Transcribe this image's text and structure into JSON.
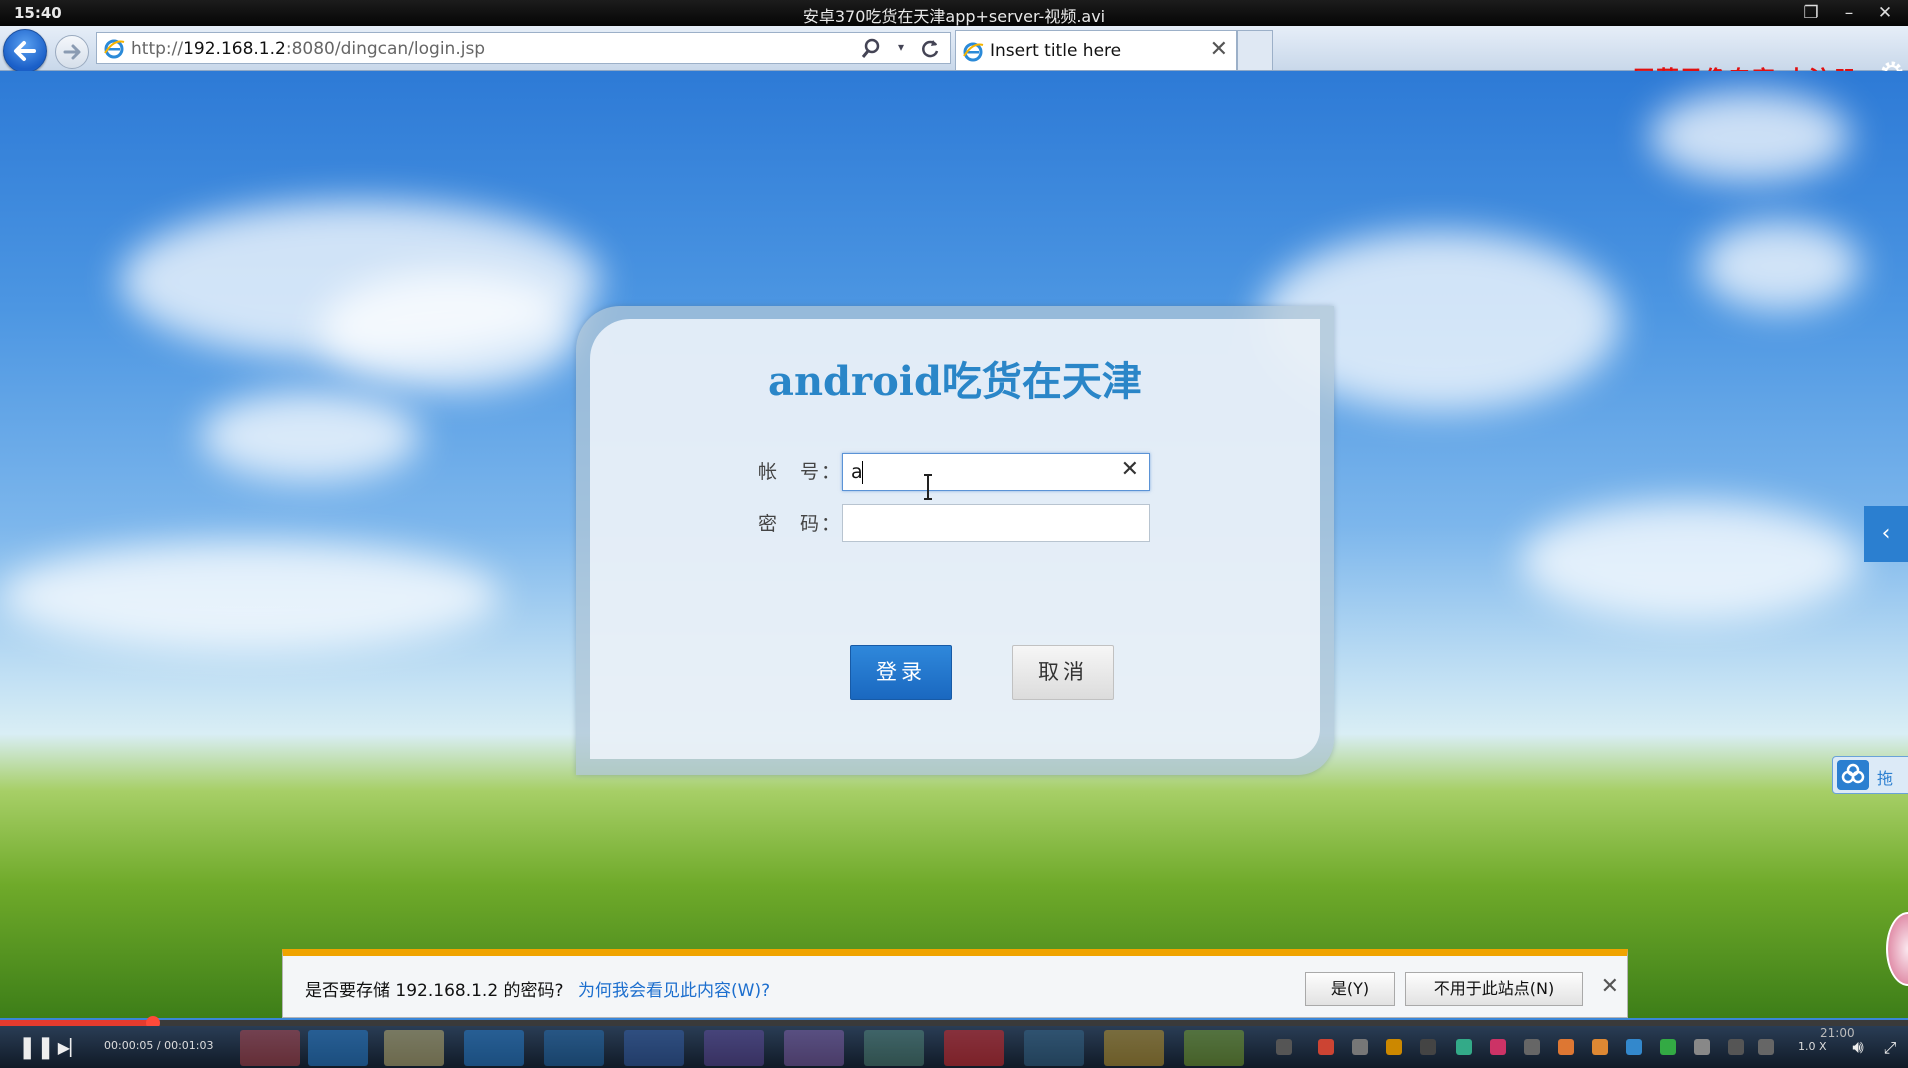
{
  "player": {
    "clock": "15:40",
    "video_title": "安卓370吃货在天津app+server-视频.avi",
    "time_display": "00:00:05 / 00:01:03",
    "playback_speed": "1.0 X",
    "tray_clock": "21:00",
    "progress_percent": 8
  },
  "browser": {
    "url_prefix": "http://",
    "url_host": "192.168.1.2",
    "url_rest": ":8080/dingcan/login.jsp",
    "tab_title": "Insert title here"
  },
  "watermark": "屏幕录像专家  未注册",
  "login": {
    "title": "android吃货在天津",
    "account_label": "帐　号：",
    "account_value": "a",
    "password_label": "密　码：",
    "password_value": "",
    "login_button": "登录",
    "cancel_button": "取消"
  },
  "side": {
    "cloud_widget_text": "拖"
  },
  "notification": {
    "question": "是否要存储 192.168.1.2 的密码?",
    "why_link": "为何我会看见此内容(W)?",
    "yes_button": "是(Y)",
    "never_button": "不用于此站点(N)"
  },
  "colors": {
    "accent_blue": "#2a86c8",
    "login_button": "#1f72cc",
    "watermark_red": "#e01010",
    "notification_bar": "#f0a400"
  },
  "icons": [
    "back-arrow-icon",
    "forward-arrow-icon",
    "ie-logo-icon",
    "search-icon",
    "refresh-icon",
    "close-icon",
    "gear-icon",
    "chevron-left-icon",
    "baidu-cloud-icon",
    "pause-icon",
    "next-track-icon",
    "volume-icon"
  ]
}
